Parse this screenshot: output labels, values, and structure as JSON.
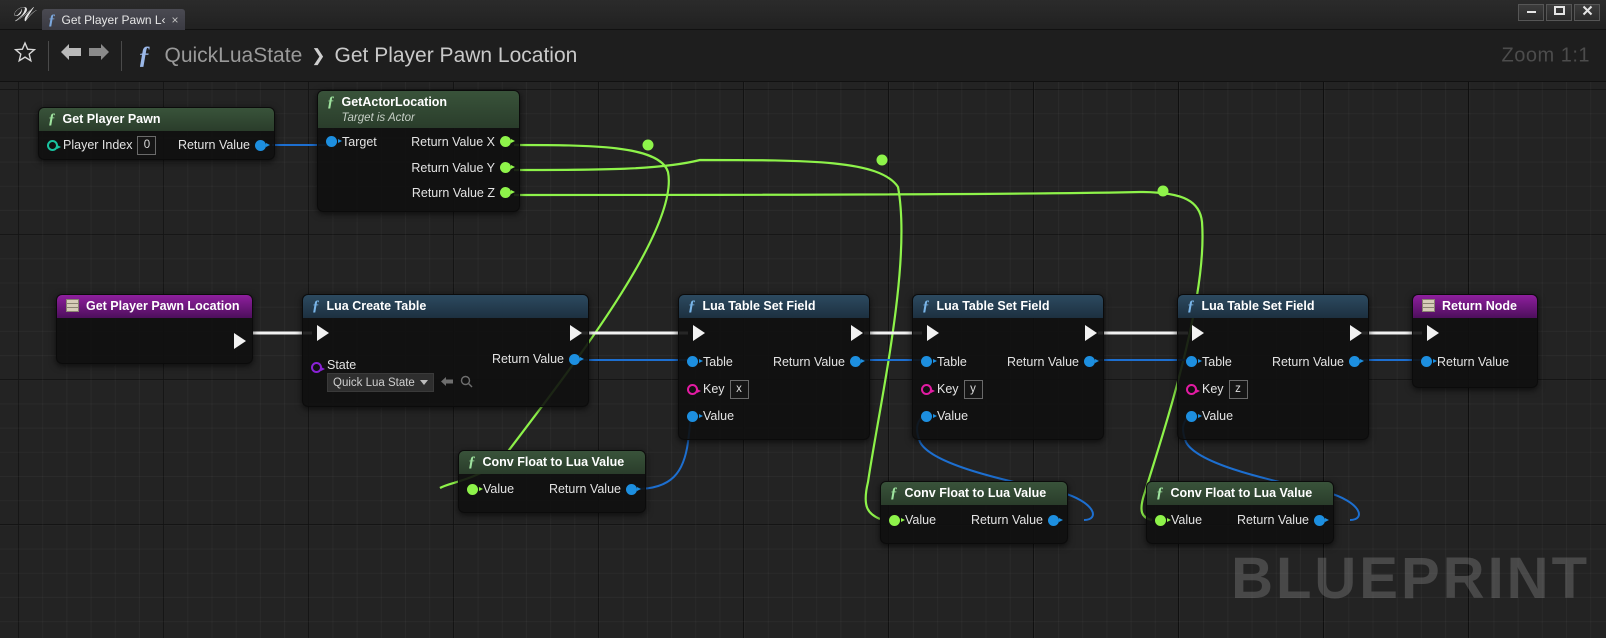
{
  "window": {
    "app_icon": "unreal-engine-logo",
    "tab": {
      "icon": "function-icon",
      "label": "Get Player Pawn L‹",
      "close": "×"
    },
    "buttons": {
      "minimize": "–",
      "maximize": "❐",
      "close": "✕"
    }
  },
  "toolbar": {
    "favorite_icon": "☆",
    "back_icon": "⬅",
    "forward_icon": "➡",
    "fx_icon": "ƒ",
    "breadcrumb": [
      "QuickLuaState",
      "Get Player Pawn Location"
    ],
    "breadcrumb_separator": "❯",
    "zoom": "Zoom 1:1"
  },
  "graph": {
    "watermark": "BLUEPRINT",
    "colors": {
      "exec_wire": "#f2f2f2",
      "object_wire": "#1d6fd0",
      "float_wire": "#8ef34a",
      "entry_header": "#8e1f9d",
      "function_header": "#3e5a3e",
      "lua_header": "#2c4a60",
      "string_pin": "#e31ba3",
      "state_pin": "#8a22d6",
      "object_pin": "#1d8fe0",
      "float_pin": "#8ef34a"
    },
    "nodes": [
      {
        "id": "get-player-pawn",
        "title": "Get Player Pawn",
        "subtitle": "",
        "icon": "function-icon",
        "inputs": [
          {
            "label": "Player Index",
            "pin": "ring",
            "value": "0"
          }
        ],
        "outputs": [
          {
            "label": "Return Value",
            "pin": "obj"
          }
        ]
      },
      {
        "id": "get-actor-location",
        "title": "GetActorLocation",
        "subtitle": "Target is Actor",
        "icon": "function-icon",
        "inputs": [
          {
            "label": "Target",
            "pin": "obj"
          }
        ],
        "outputs": [
          {
            "label": "Return Value X",
            "pin": "float"
          },
          {
            "label": "Return Value Y",
            "pin": "float"
          },
          {
            "label": "Return Value Z",
            "pin": "float"
          }
        ]
      },
      {
        "id": "entry",
        "title": "Get Player Pawn Location",
        "icon": "entry-node-icon",
        "exec_out": true
      },
      {
        "id": "lua-create-table",
        "title": "Lua Create Table",
        "icon": "function-icon",
        "exec_in": true,
        "exec_out": true,
        "inputs": [
          {
            "label": "State",
            "pin": "prp",
            "dropdown": "Quick Lua State"
          }
        ],
        "outputs": [
          {
            "label": "Return Value",
            "pin": "obj"
          }
        ],
        "dropdown_caret": "▾",
        "dropdown_back_icon": "⬅",
        "dropdown_browse_icon": "⌕"
      },
      {
        "id": "lua-table-set-field-x",
        "title": "Lua Table Set Field",
        "icon": "function-icon",
        "exec_in": true,
        "exec_out": true,
        "inputs": [
          {
            "label": "Table",
            "pin": "obj"
          },
          {
            "label": "Key",
            "pin": "str",
            "value": "x"
          },
          {
            "label": "Value",
            "pin": "obj"
          }
        ],
        "outputs": [
          {
            "label": "Return Value",
            "pin": "obj"
          }
        ]
      },
      {
        "id": "lua-table-set-field-y",
        "title": "Lua Table Set Field",
        "icon": "function-icon",
        "exec_in": true,
        "exec_out": true,
        "inputs": [
          {
            "label": "Table",
            "pin": "obj"
          },
          {
            "label": "Key",
            "pin": "str",
            "value": "y"
          },
          {
            "label": "Value",
            "pin": "obj"
          }
        ],
        "outputs": [
          {
            "label": "Return Value",
            "pin": "obj"
          }
        ]
      },
      {
        "id": "lua-table-set-field-z",
        "title": "Lua Table Set Field",
        "icon": "function-icon",
        "exec_in": true,
        "exec_out": true,
        "inputs": [
          {
            "label": "Table",
            "pin": "obj"
          },
          {
            "label": "Key",
            "pin": "str",
            "value": "z"
          },
          {
            "label": "Value",
            "pin": "obj"
          }
        ],
        "outputs": [
          {
            "label": "Return Value",
            "pin": "obj"
          }
        ]
      },
      {
        "id": "return-node",
        "title": "Return Node",
        "icon": "return-node-icon",
        "exec_in": true,
        "inputs": [
          {
            "label": "Return Value",
            "pin": "obj"
          }
        ]
      },
      {
        "id": "conv-float-x",
        "title": "Conv Float to Lua Value",
        "icon": "function-icon",
        "inputs": [
          {
            "label": "Value",
            "pin": "float"
          }
        ],
        "outputs": [
          {
            "label": "Return Value",
            "pin": "obj"
          }
        ]
      },
      {
        "id": "conv-float-y",
        "title": "Conv Float to Lua Value",
        "icon": "function-icon",
        "inputs": [
          {
            "label": "Value",
            "pin": "float"
          }
        ],
        "outputs": [
          {
            "label": "Return Value",
            "pin": "obj"
          }
        ]
      },
      {
        "id": "conv-float-z",
        "title": "Conv Float to Lua Value",
        "icon": "function-icon",
        "inputs": [
          {
            "label": "Value",
            "pin": "float"
          }
        ],
        "outputs": [
          {
            "label": "Return Value",
            "pin": "obj"
          }
        ]
      }
    ]
  }
}
